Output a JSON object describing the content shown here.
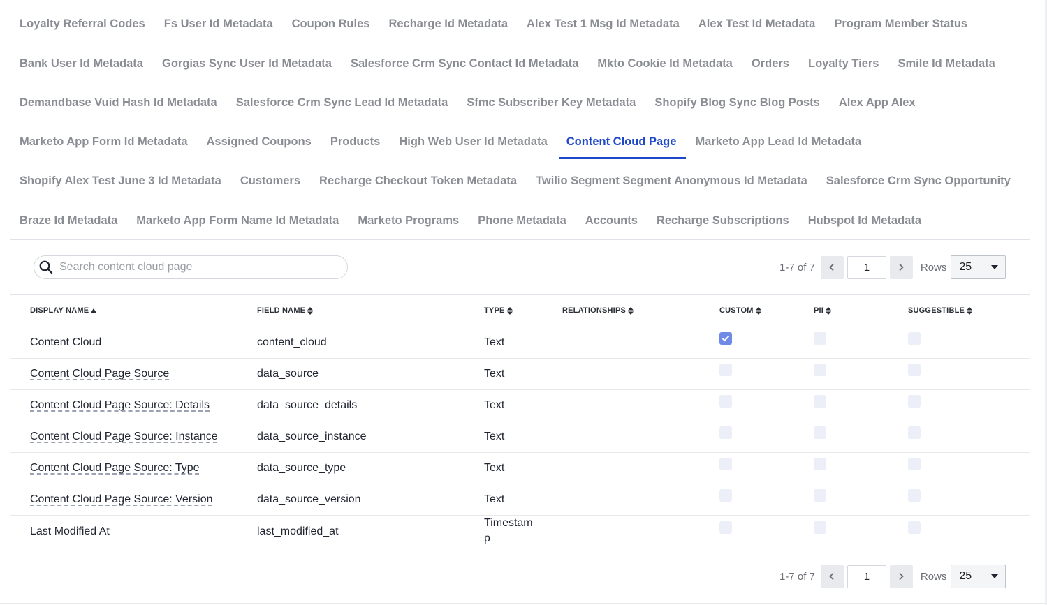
{
  "tabs": {
    "row1": [
      "Loyalty Referral Codes",
      "Fs User Id Metadata",
      "Coupon Rules",
      "Recharge Id Metadata",
      "Alex Test 1 Msg Id Metadata",
      "Alex Test Id Metadata",
      "Program Member Status"
    ],
    "row2": [
      "Bank User Id Metadata",
      "Gorgias Sync User Id Metadata",
      "Salesforce Crm Sync Contact Id Metadata",
      "Mkto Cookie Id Metadata",
      "Orders",
      "Loyalty Tiers",
      "Smile Id Metadata"
    ],
    "row3": [
      "Demandbase Vuid Hash Id Metadata",
      "Salesforce Crm Sync Lead Id Metadata",
      "Sfmc Subscriber Key Metadata",
      "Shopify Blog Sync Blog Posts",
      "Alex App Alex"
    ],
    "row4": [
      "Marketo App Form Id Metadata",
      "Assigned Coupons",
      "Products",
      "High Web User Id Metadata",
      "Content Cloud Page",
      "Marketo App Lead Id Metadata"
    ],
    "row5": [
      "Shopify Alex Test June 3 Id Metadata",
      "Customers",
      "Recharge Checkout Token Metadata",
      "Twilio Segment Segment Anonymous Id Metadata",
      "Salesforce Crm Sync Opportunity"
    ],
    "row6": [
      "Braze Id Metadata",
      "Marketo App Form Name Id Metadata",
      "Marketo Programs",
      "Phone Metadata",
      "Accounts",
      "Recharge Subscriptions",
      "Hubspot Id Metadata"
    ],
    "active": "Content Cloud Page"
  },
  "search": {
    "placeholder": "Search content cloud page",
    "value": ""
  },
  "pagination": {
    "range": "1-7 of 7",
    "page": "1",
    "rows_label": "Rows",
    "rows_value": "25"
  },
  "table": {
    "headers": {
      "display_name": "DISPLAY NAME",
      "field_name": "FIELD NAME",
      "type": "TYPE",
      "relationships": "RELATIONSHIPS",
      "custom": "CUSTOM",
      "pii": "PII",
      "suggestible": "SUGGESTIBLE"
    },
    "rows": [
      {
        "display_name": "Content Cloud",
        "field_name": "content_cloud",
        "type": "Text",
        "custom": true,
        "pii": false,
        "suggestible": false
      },
      {
        "display_name": "Content Cloud Page Source",
        "field_name": "data_source",
        "type": "Text",
        "custom": false,
        "pii": false,
        "suggestible": false
      },
      {
        "display_name": "Content Cloud Page Source: Details",
        "field_name": "data_source_details",
        "type": "Text",
        "custom": false,
        "pii": false,
        "suggestible": false
      },
      {
        "display_name": "Content Cloud Page Source: Instance",
        "field_name": "data_source_instance",
        "type": "Text",
        "custom": false,
        "pii": false,
        "suggestible": false
      },
      {
        "display_name": "Content Cloud Page Source: Type",
        "field_name": "data_source_type",
        "type": "Text",
        "custom": false,
        "pii": false,
        "suggestible": false
      },
      {
        "display_name": "Content Cloud Page Source: Version",
        "field_name": "data_source_version",
        "type": "Text",
        "custom": false,
        "pii": false,
        "suggestible": false
      },
      {
        "display_name": "Last Modified At",
        "field_name": "last_modified_at",
        "type_line1": "Timestam",
        "type_line2": "p",
        "custom": false,
        "pii": false,
        "suggestible": false
      }
    ]
  },
  "colors": {
    "accent": "#1f48c9",
    "tab_text": "#8a8d93",
    "checkbox_checked": "#6f8ae6",
    "checkbox_empty": "#eceef8"
  },
  "icons": {
    "search": "search-icon",
    "prev": "chevron-left-icon",
    "next": "chevron-right-icon",
    "dropdown": "caret-down-icon",
    "sort": "sort-icon",
    "sort_asc": "sort-asc-icon",
    "check": "check-icon"
  }
}
